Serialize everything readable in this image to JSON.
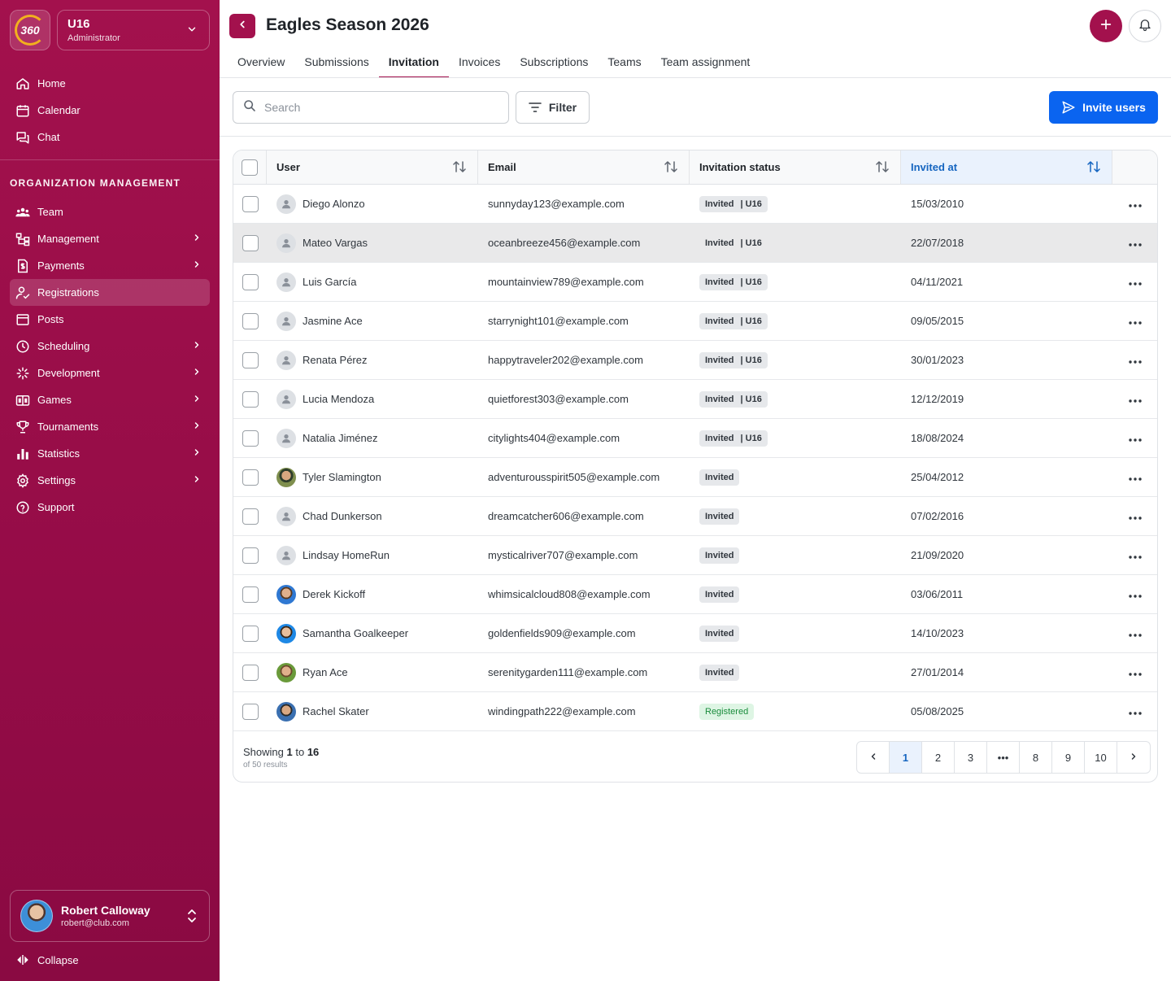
{
  "org": {
    "logo_text": "360",
    "name": "U16",
    "role": "Administrator"
  },
  "nav_main": [
    {
      "label": "Home",
      "icon": "home-icon"
    },
    {
      "label": "Calendar",
      "icon": "calendar-icon"
    },
    {
      "label": "Chat",
      "icon": "chat-icon"
    }
  ],
  "section_label": "ORGANIZATION MANAGEMENT",
  "nav_org": [
    {
      "label": "Team",
      "icon": "team-icon",
      "chevron": false
    },
    {
      "label": "Management",
      "icon": "hierarchy-icon",
      "chevron": true
    },
    {
      "label": "Payments",
      "icon": "invoice-icon",
      "chevron": true
    },
    {
      "label": "Registrations",
      "icon": "user-check-icon",
      "chevron": false,
      "active": true
    },
    {
      "label": "Posts",
      "icon": "post-icon",
      "chevron": false
    },
    {
      "label": "Scheduling",
      "icon": "clock-icon",
      "chevron": true
    },
    {
      "label": "Development",
      "icon": "sparkle-icon",
      "chevron": true
    },
    {
      "label": "Games",
      "icon": "scoreboard-icon",
      "chevron": true
    },
    {
      "label": "Tournaments",
      "icon": "trophy-icon",
      "chevron": true
    },
    {
      "label": "Statistics",
      "icon": "bar-chart-icon",
      "chevron": true
    },
    {
      "label": "Settings",
      "icon": "gear-icon",
      "chevron": true
    },
    {
      "label": "Support",
      "icon": "help-icon",
      "chevron": false
    }
  ],
  "user": {
    "name": "Robert Calloway",
    "email": "robert@club.com"
  },
  "collapse_label": "Collapse",
  "header": {
    "title": "Eagles Season 2026"
  },
  "tabs": [
    "Overview",
    "Submissions",
    "Invitation",
    "Invoices",
    "Subscriptions",
    "Teams",
    "Team assignment"
  ],
  "active_tab": "Invitation",
  "search": {
    "placeholder": "Search",
    "value": ""
  },
  "filter_label": "Filter",
  "invite_label": "Invite users",
  "table": {
    "columns": [
      "User",
      "Email",
      "Invitation status",
      "Invited at"
    ],
    "sorted_column": "Invited at",
    "rows": [
      {
        "name": "Diego Alonzo",
        "email": "sunnyday123@example.com",
        "status": "Invited",
        "team": "U16",
        "date": "15/03/2010",
        "avatar": "default"
      },
      {
        "name": "Mateo Vargas",
        "email": "oceanbreeze456@example.com",
        "status": "Invited",
        "team": "U16",
        "date": "22/07/2018",
        "avatar": "default",
        "hover": true
      },
      {
        "name": "Luis García",
        "email": "mountainview789@example.com",
        "status": "Invited",
        "team": "U16",
        "date": "04/11/2021",
        "avatar": "default"
      },
      {
        "name": "Jasmine Ace",
        "email": "starrynight101@example.com",
        "status": "Invited",
        "team": "U16",
        "date": "09/05/2015",
        "avatar": "default"
      },
      {
        "name": "Renata Pérez",
        "email": "happytraveler202@example.com",
        "status": "Invited",
        "team": "U16",
        "date": "30/01/2023",
        "avatar": "default"
      },
      {
        "name": "Lucia Mendoza",
        "email": "quietforest303@example.com",
        "status": "Invited",
        "team": "U16",
        "date": "12/12/2019",
        "avatar": "default"
      },
      {
        "name": "Natalia Jiménez",
        "email": "citylights404@example.com",
        "status": "Invited",
        "team": "U16",
        "date": "18/08/2024",
        "avatar": "default"
      },
      {
        "name": "Tyler Slamington",
        "email": "adventurousspirit505@example.com",
        "status": "Invited",
        "team": "",
        "date": "25/04/2012",
        "avatar": "photo1"
      },
      {
        "name": "Chad Dunkerson",
        "email": "dreamcatcher606@example.com",
        "status": "Invited",
        "team": "",
        "date": "07/02/2016",
        "avatar": "default"
      },
      {
        "name": "Lindsay HomeRun",
        "email": "mysticalriver707@example.com",
        "status": "Invited",
        "team": "",
        "date": "21/09/2020",
        "avatar": "default"
      },
      {
        "name": "Derek Kickoff",
        "email": "whimsicalcloud808@example.com",
        "status": "Invited",
        "team": "",
        "date": "03/06/2011",
        "avatar": "photo2"
      },
      {
        "name": "Samantha Goalkeeper",
        "email": "goldenfields909@example.com",
        "status": "Invited",
        "team": "",
        "date": "14/10/2023",
        "avatar": "photo3"
      },
      {
        "name": "Ryan Ace",
        "email": "serenitygarden111@example.com",
        "status": "Invited",
        "team": "",
        "date": "27/01/2014",
        "avatar": "photo4"
      },
      {
        "name": "Rachel Skater",
        "email": "windingpath222@example.com",
        "status": "Registered",
        "team": "",
        "date": "05/08/2025",
        "avatar": "photo5"
      }
    ]
  },
  "pagination": {
    "showing_prefix": "Showing",
    "from": "1",
    "to_word": "to",
    "to": "16",
    "results": "of 50 results",
    "pages": [
      "1",
      "2",
      "3",
      "•••",
      "8",
      "9",
      "10"
    ],
    "current": "1"
  },
  "colors": {
    "brand": "#a3114d",
    "accent": "#0a64f0",
    "registered": "#1a8c3c"
  }
}
